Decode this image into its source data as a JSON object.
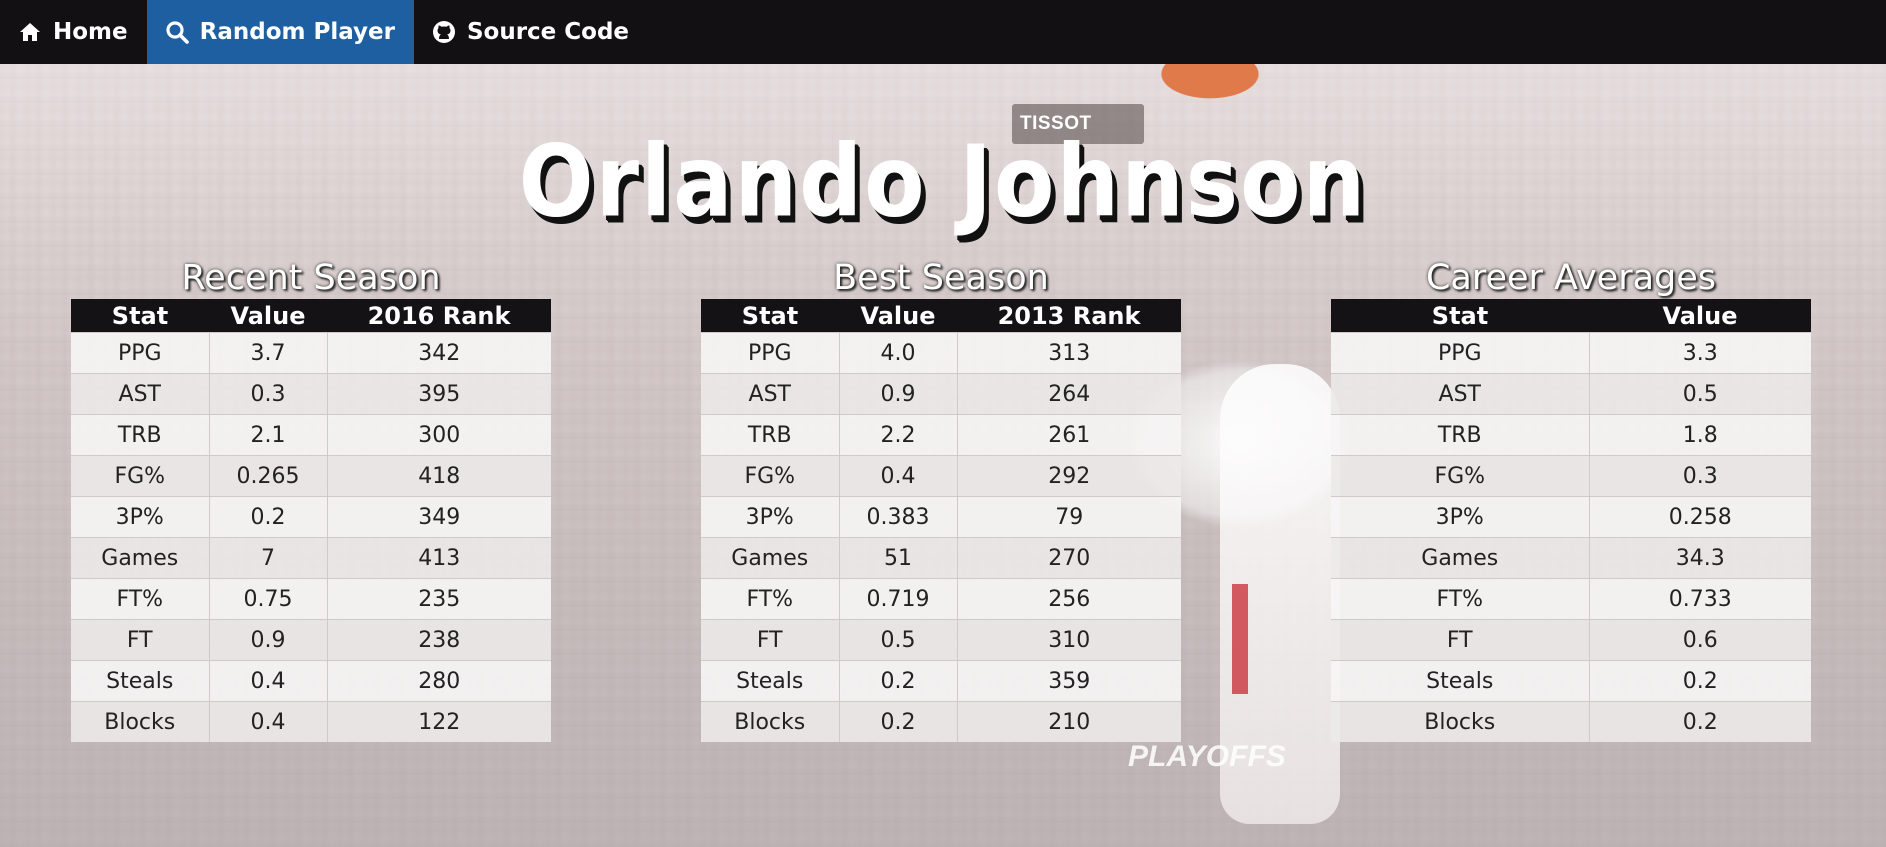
{
  "nav": {
    "home": {
      "label": "Home",
      "icon": "home-icon"
    },
    "random": {
      "label": "Random Player",
      "icon": "search-icon"
    },
    "source": {
      "label": "Source Code",
      "icon": "github-icon"
    }
  },
  "background": {
    "scoreboard_text": "TISSOT",
    "banner_text": "PLAYOFFS"
  },
  "player_name": "Orlando Johnson",
  "recent": {
    "title": "Recent Season",
    "headers": [
      "Stat",
      "Value",
      "2016 Rank"
    ],
    "rows": [
      [
        "PPG",
        "3.7",
        "342"
      ],
      [
        "AST",
        "0.3",
        "395"
      ],
      [
        "TRB",
        "2.1",
        "300"
      ],
      [
        "FG%",
        "0.265",
        "418"
      ],
      [
        "3P%",
        "0.2",
        "349"
      ],
      [
        "Games",
        "7",
        "413"
      ],
      [
        "FT%",
        "0.75",
        "235"
      ],
      [
        "FT",
        "0.9",
        "238"
      ],
      [
        "Steals",
        "0.4",
        "280"
      ],
      [
        "Blocks",
        "0.4",
        "122"
      ]
    ]
  },
  "best": {
    "title": "Best Season",
    "headers": [
      "Stat",
      "Value",
      "2013 Rank"
    ],
    "rows": [
      [
        "PPG",
        "4.0",
        "313"
      ],
      [
        "AST",
        "0.9",
        "264"
      ],
      [
        "TRB",
        "2.2",
        "261"
      ],
      [
        "FG%",
        "0.4",
        "292"
      ],
      [
        "3P%",
        "0.383",
        "79"
      ],
      [
        "Games",
        "51",
        "270"
      ],
      [
        "FT%",
        "0.719",
        "256"
      ],
      [
        "FT",
        "0.5",
        "310"
      ],
      [
        "Steals",
        "0.2",
        "359"
      ],
      [
        "Blocks",
        "0.2",
        "210"
      ]
    ]
  },
  "career": {
    "title": "Career Averages",
    "headers": [
      "Stat",
      "Value"
    ],
    "rows": [
      [
        "PPG",
        "3.3"
      ],
      [
        "AST",
        "0.5"
      ],
      [
        "TRB",
        "1.8"
      ],
      [
        "FG%",
        "0.3"
      ],
      [
        "3P%",
        "0.258"
      ],
      [
        "Games",
        "34.3"
      ],
      [
        "FT%",
        "0.733"
      ],
      [
        "FT",
        "0.6"
      ],
      [
        "Steals",
        "0.2"
      ],
      [
        "Blocks",
        "0.2"
      ]
    ]
  },
  "colors": {
    "navbar": "#121012",
    "nav_active": "#1d5fa0",
    "table_header": "#141214"
  }
}
